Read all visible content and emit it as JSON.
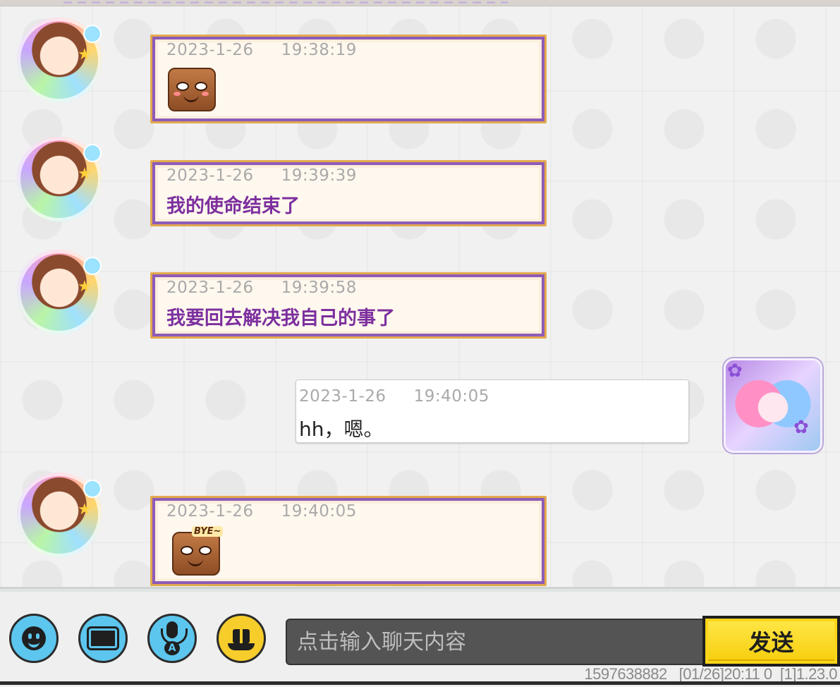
{
  "chat": {
    "messages": [
      {
        "sender": "other",
        "date": "2023-1-26",
        "time": "19:38:19",
        "text": "",
        "sticker": "brown-block-smirk-sticker"
      },
      {
        "sender": "other",
        "date": "2023-1-26",
        "time": "19:39:39",
        "text": "我的使命结束了"
      },
      {
        "sender": "other",
        "date": "2023-1-26",
        "time": "19:39:58",
        "text": "我要回去解决我自己的事了"
      },
      {
        "sender": "me",
        "date": "2023-1-26",
        "time": "19:40:05",
        "text": "hh，嗯。"
      },
      {
        "sender": "other",
        "date": "2023-1-26",
        "time": "19:40:05",
        "text": "",
        "sticker": "brown-block-bye-sticker",
        "sticker_label": "BYE~"
      }
    ]
  },
  "input_bar": {
    "placeholder": "点击输入聊天内容",
    "send_label": "发送",
    "buttons": [
      "emoji-icon",
      "keyboard-icon",
      "voice-mic-icon",
      "gift-icon"
    ]
  },
  "status": {
    "user_id": "1597638882",
    "timestamp": "[01/26]20:11 0",
    "version": "[1]1.23.0"
  },
  "colors": {
    "other_bubble_border": "#e2a94d",
    "other_bubble_frame": "#8e5bb8",
    "other_text": "#7c2f9e",
    "send_button": "#f6cd0a",
    "round_button": "#5cc6ee"
  }
}
